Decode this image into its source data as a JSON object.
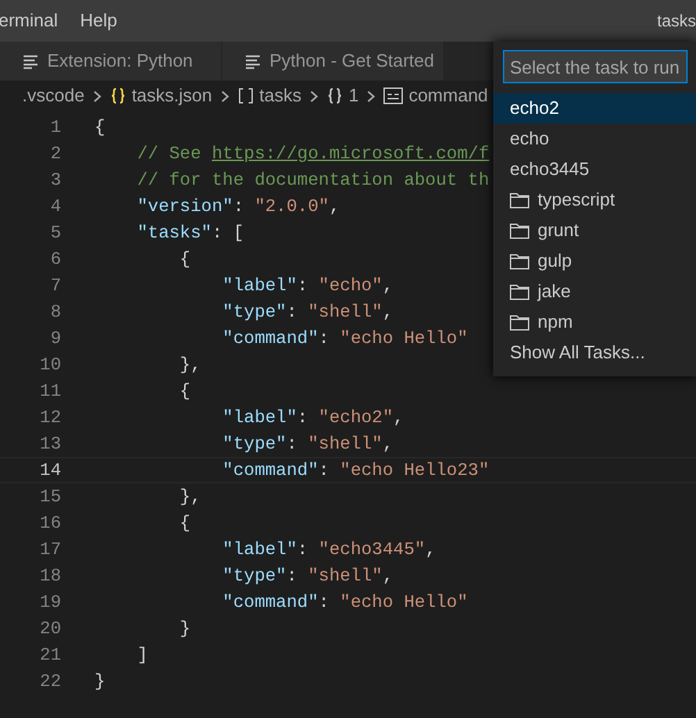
{
  "menu_bar": {
    "items": [
      "erminal",
      "Help"
    ],
    "title": "tasks"
  },
  "tabs": [
    {
      "label": "Extension: Python",
      "selected": false
    },
    {
      "label": "Python - Get Started",
      "selected": false
    }
  ],
  "breadcrumb": [
    {
      "label": ".vscode",
      "kind": "folder"
    },
    {
      "label": "tasks.json",
      "kind": "file"
    },
    {
      "label": "tasks",
      "kind": "array"
    },
    {
      "label": "1",
      "kind": "object"
    },
    {
      "label": "command",
      "kind": "string"
    }
  ],
  "editor": {
    "lines": [
      {
        "number": "1",
        "current": false,
        "tokens": [
          {
            "text": "{",
            "kind": "punct"
          }
        ]
      },
      {
        "number": "2",
        "current": false,
        "tokens": [
          {
            "text": "    // See ",
            "kind": "comment"
          },
          {
            "text": "https://go.microsoft.com/f",
            "kind": "link"
          }
        ]
      },
      {
        "number": "3",
        "current": false,
        "tokens": [
          {
            "text": "    // for the documentation about th",
            "kind": "comment"
          }
        ]
      },
      {
        "number": "4",
        "current": false,
        "tokens": [
          {
            "text": "    \"version\"",
            "kind": "key"
          },
          {
            "text": ": ",
            "kind": "punct"
          },
          {
            "text": "\"2.0.0\"",
            "kind": "string"
          },
          {
            "text": ",",
            "kind": "punct"
          }
        ]
      },
      {
        "number": "5",
        "current": false,
        "tokens": [
          {
            "text": "    \"tasks\"",
            "kind": "key"
          },
          {
            "text": ": [",
            "kind": "punct"
          }
        ]
      },
      {
        "number": "6",
        "current": false,
        "tokens": [
          {
            "text": "        {",
            "kind": "punct"
          }
        ]
      },
      {
        "number": "7",
        "current": false,
        "tokens": [
          {
            "text": "            \"label\"",
            "kind": "key"
          },
          {
            "text": ": ",
            "kind": "punct"
          },
          {
            "text": "\"echo\"",
            "kind": "string"
          },
          {
            "text": ",",
            "kind": "punct"
          }
        ]
      },
      {
        "number": "8",
        "current": false,
        "tokens": [
          {
            "text": "            \"type\"",
            "kind": "key"
          },
          {
            "text": ": ",
            "kind": "punct"
          },
          {
            "text": "\"shell\"",
            "kind": "string"
          },
          {
            "text": ",",
            "kind": "punct"
          }
        ]
      },
      {
        "number": "9",
        "current": false,
        "tokens": [
          {
            "text": "            \"command\"",
            "kind": "key"
          },
          {
            "text": ": ",
            "kind": "punct"
          },
          {
            "text": "\"echo Hello\"",
            "kind": "string"
          }
        ]
      },
      {
        "number": "10",
        "current": false,
        "tokens": [
          {
            "text": "        },",
            "kind": "punct"
          }
        ]
      },
      {
        "number": "11",
        "current": false,
        "tokens": [
          {
            "text": "        {",
            "kind": "punct"
          }
        ]
      },
      {
        "number": "12",
        "current": false,
        "tokens": [
          {
            "text": "            \"label\"",
            "kind": "key"
          },
          {
            "text": ": ",
            "kind": "punct"
          },
          {
            "text": "\"echo2\"",
            "kind": "string"
          },
          {
            "text": ",",
            "kind": "punct"
          }
        ]
      },
      {
        "number": "13",
        "current": false,
        "tokens": [
          {
            "text": "            \"type\"",
            "kind": "key"
          },
          {
            "text": ": ",
            "kind": "punct"
          },
          {
            "text": "\"shell\"",
            "kind": "string"
          },
          {
            "text": ",",
            "kind": "punct"
          }
        ]
      },
      {
        "number": "14",
        "current": true,
        "tokens": [
          {
            "text": "            \"command\"",
            "kind": "key"
          },
          {
            "text": ": ",
            "kind": "punct"
          },
          {
            "text": "\"echo Hello23\"",
            "kind": "string"
          }
        ]
      },
      {
        "number": "15",
        "current": false,
        "tokens": [
          {
            "text": "        },",
            "kind": "punct"
          }
        ]
      },
      {
        "number": "16",
        "current": false,
        "tokens": [
          {
            "text": "        {",
            "kind": "punct"
          }
        ]
      },
      {
        "number": "17",
        "current": false,
        "tokens": [
          {
            "text": "            \"label\"",
            "kind": "key"
          },
          {
            "text": ": ",
            "kind": "punct"
          },
          {
            "text": "\"echo3445\"",
            "kind": "string"
          },
          {
            "text": ",",
            "kind": "punct"
          }
        ]
      },
      {
        "number": "18",
        "current": false,
        "tokens": [
          {
            "text": "            \"type\"",
            "kind": "key"
          },
          {
            "text": ": ",
            "kind": "punct"
          },
          {
            "text": "\"shell\"",
            "kind": "string"
          },
          {
            "text": ",",
            "kind": "punct"
          }
        ]
      },
      {
        "number": "19",
        "current": false,
        "tokens": [
          {
            "text": "            \"command\"",
            "kind": "key"
          },
          {
            "text": ": ",
            "kind": "punct"
          },
          {
            "text": "\"echo Hello\"",
            "kind": "string"
          }
        ]
      },
      {
        "number": "20",
        "current": false,
        "tokens": [
          {
            "text": "        }",
            "kind": "punct"
          }
        ]
      },
      {
        "number": "21",
        "current": false,
        "tokens": [
          {
            "text": "    ]",
            "kind": "punct"
          }
        ]
      },
      {
        "number": "22",
        "current": false,
        "tokens": [
          {
            "text": "}",
            "kind": "punct"
          }
        ]
      }
    ]
  },
  "quick_pick": {
    "placeholder": "Select the task to run",
    "items": [
      {
        "label": "echo2",
        "kind": "task",
        "selected": true
      },
      {
        "label": "echo",
        "kind": "task",
        "selected": false
      },
      {
        "label": "echo3445",
        "kind": "task",
        "selected": false
      },
      {
        "label": "typescript",
        "kind": "folder",
        "selected": false
      },
      {
        "label": "grunt",
        "kind": "folder",
        "selected": false
      },
      {
        "label": "gulp",
        "kind": "folder",
        "selected": false
      },
      {
        "label": "jake",
        "kind": "folder",
        "selected": false
      },
      {
        "label": "npm",
        "kind": "folder",
        "selected": false
      },
      {
        "label": "Show All Tasks...",
        "kind": "action",
        "selected": false
      }
    ]
  }
}
